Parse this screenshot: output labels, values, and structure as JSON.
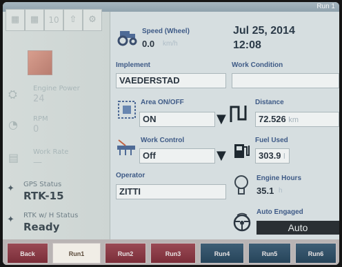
{
  "window": {
    "run_title": "Run 1"
  },
  "left_panel": {
    "toolbar": {
      "counter": "10"
    },
    "engine_power": {
      "label": "Engine Power",
      "value": "24"
    },
    "rpm": {
      "label": "RPM",
      "value": "0"
    },
    "work_rate": {
      "label": "Work Rate",
      "value": "—"
    },
    "gps_status": {
      "label": "GPS Status",
      "value": "RTK-15"
    },
    "rtk_status": {
      "label": "RTK w/ H Status",
      "value": "Ready"
    }
  },
  "main": {
    "speed": {
      "label": "Speed (Wheel)",
      "value": "0.0",
      "unit": "km/h"
    },
    "date": "Jul 25, 2014",
    "time": "12:08",
    "implement": {
      "label": "Implement",
      "value": "VAEDERSTAD"
    },
    "work_condition": {
      "label": "Work Condition",
      "value": ""
    },
    "area_onoff": {
      "label": "Area ON/OFF",
      "value": "ON"
    },
    "distance": {
      "label": "Distance",
      "value": "72.526",
      "unit": "km"
    },
    "work_control": {
      "label": "Work Control",
      "value": "Off"
    },
    "fuel_used": {
      "label": "Fuel Used",
      "value": "303.9",
      "unit": "l"
    },
    "operator": {
      "label": "Operator",
      "value": "ZITTI"
    },
    "engine_hours": {
      "label": "Engine Hours",
      "value": "35.1",
      "unit": "h"
    },
    "auto_engaged": {
      "label": "Auto Engaged",
      "value": "Auto"
    }
  },
  "tabs": [
    "Back",
    "Run1",
    "Run2",
    "Run3",
    "Run4",
    "Run5",
    "Run6"
  ]
}
